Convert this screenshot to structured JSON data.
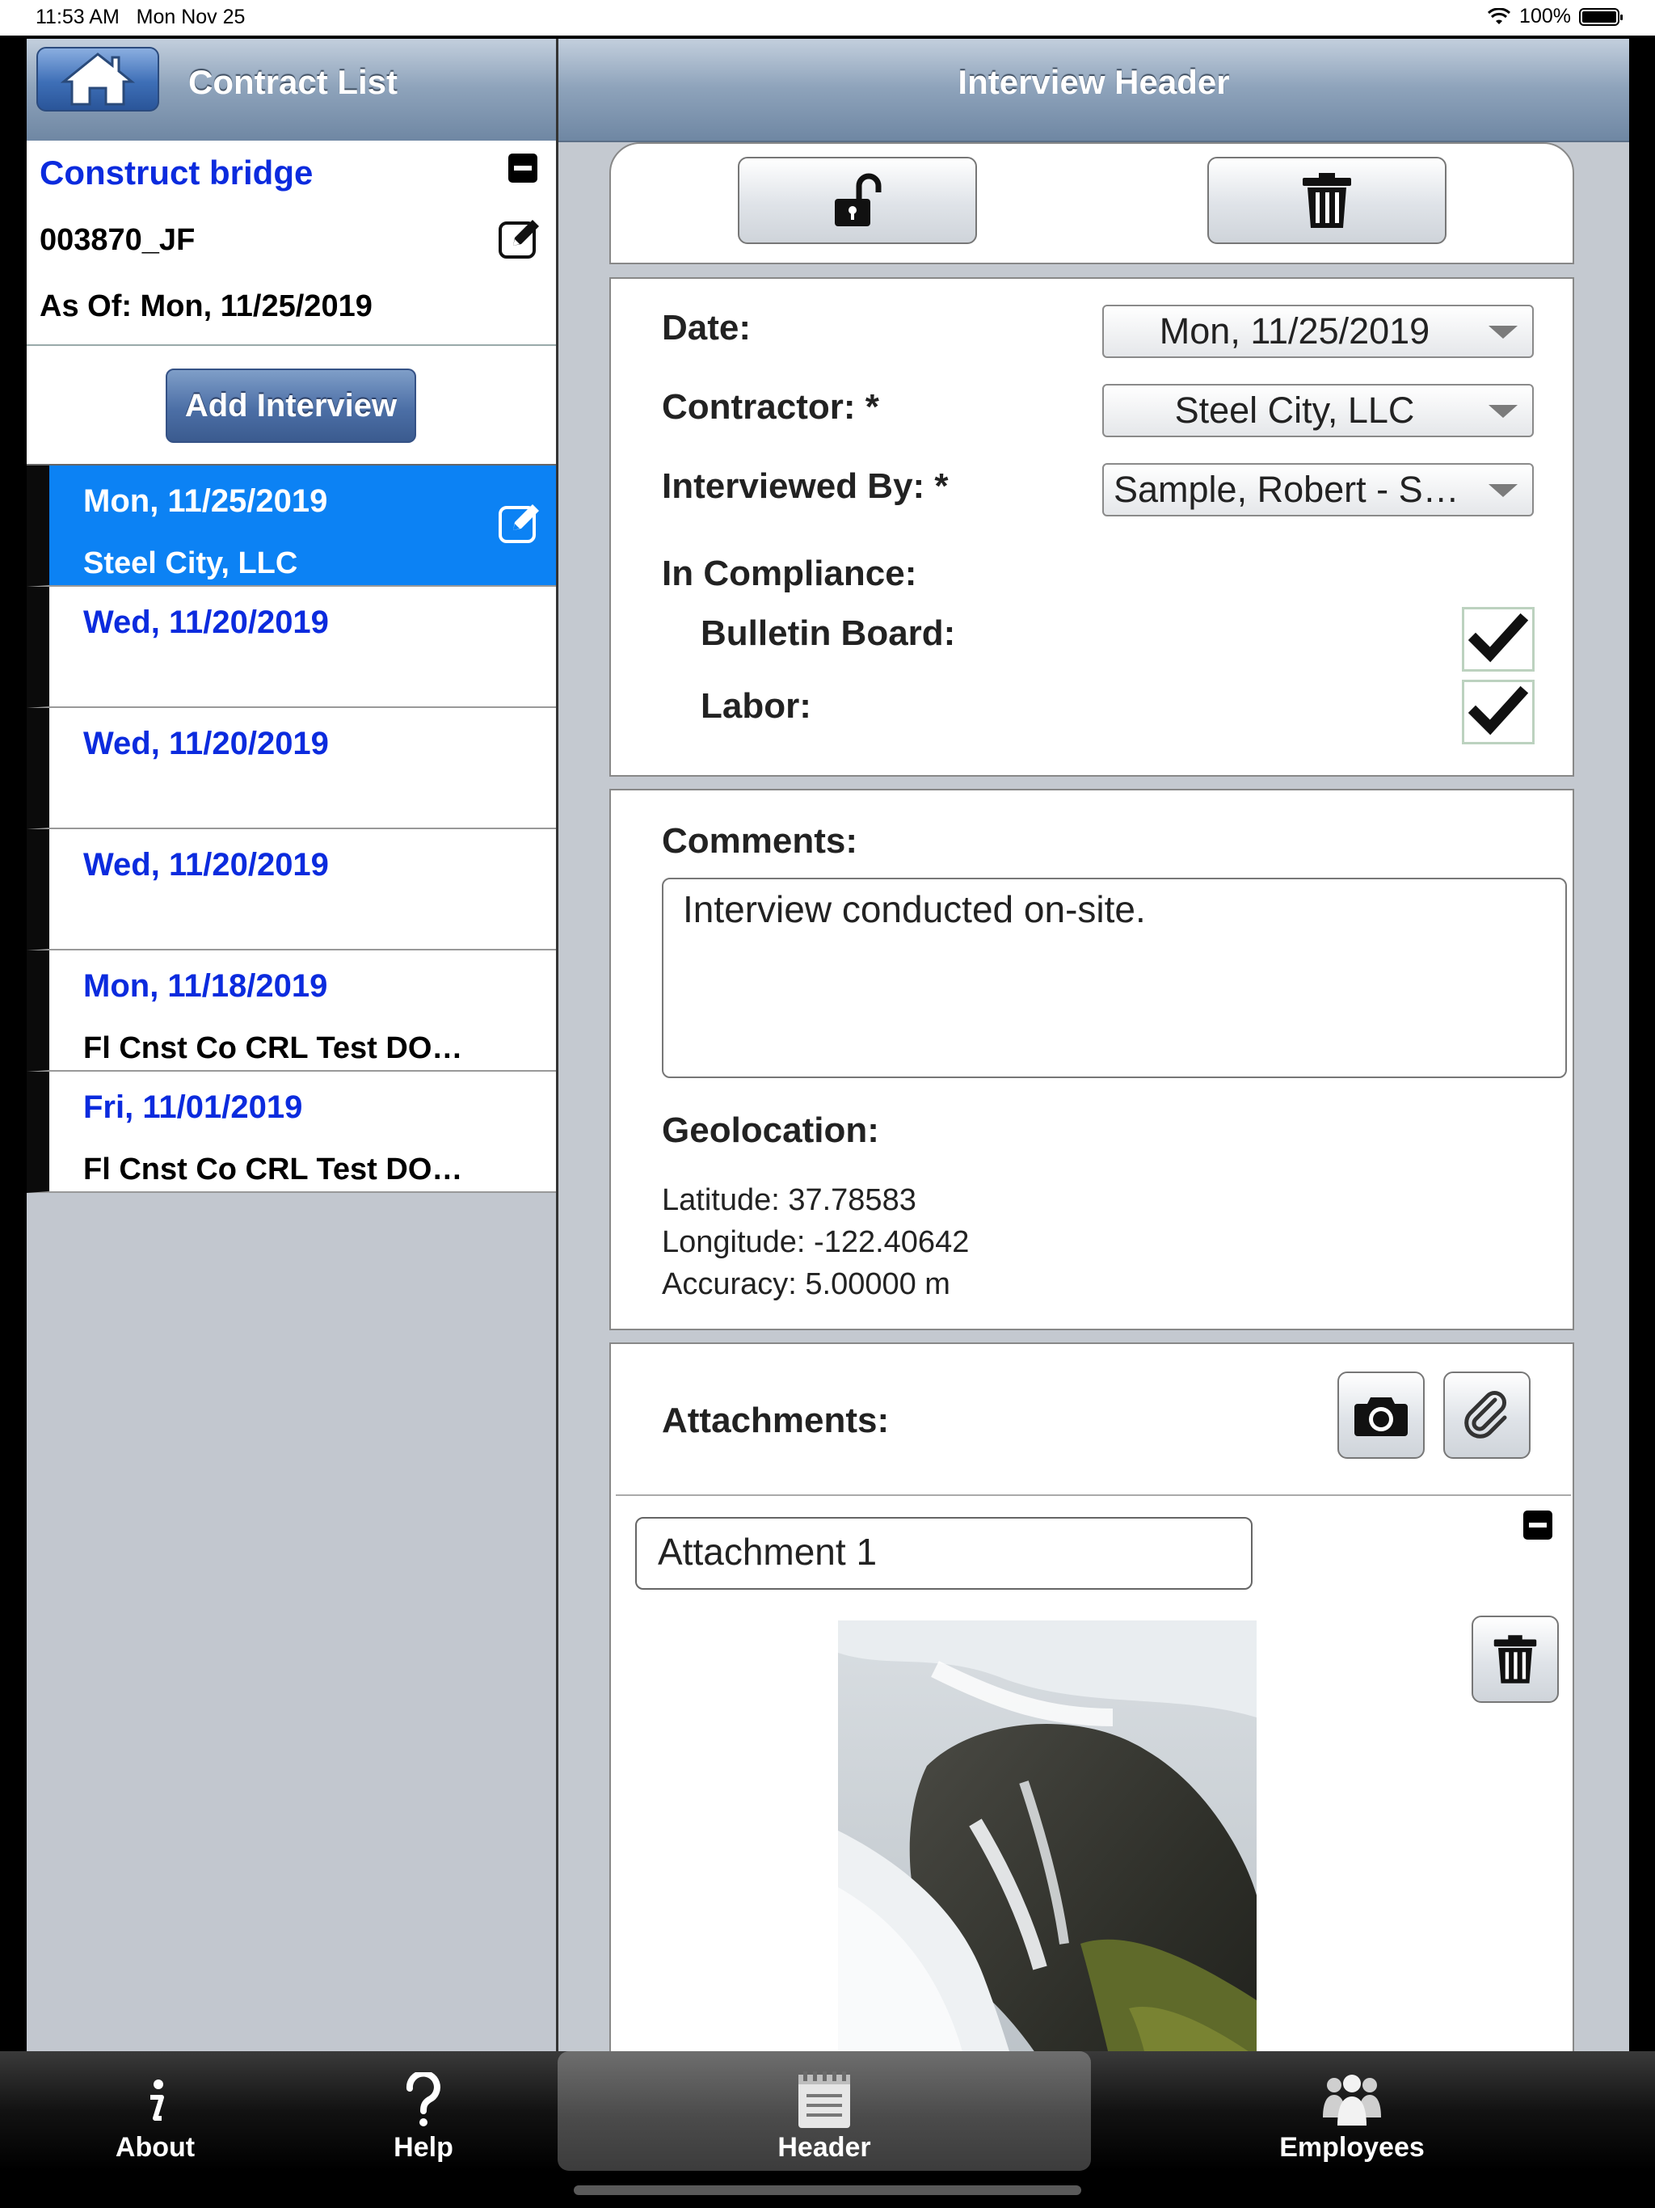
{
  "status_bar": {
    "time": "11:53 AM",
    "date": "Mon Nov 25",
    "battery": "100%"
  },
  "left": {
    "nav_title": "Contract List",
    "contract": {
      "title": "Construct bridge",
      "number": "003870_JF",
      "as_of": "As Of: Mon, 11/25/2019"
    },
    "add_interview_label": "Add Interview",
    "interviews": [
      {
        "date": "Mon, 11/25/2019",
        "contractor": "Steel City, LLC",
        "selected": true
      },
      {
        "date": "Wed, 11/20/2019",
        "contractor": ""
      },
      {
        "date": "Wed, 11/20/2019",
        "contractor": ""
      },
      {
        "date": "Wed, 11/20/2019",
        "contractor": ""
      },
      {
        "date": "Mon, 11/18/2019",
        "contractor": "Fl Cnst Co CRL Test DO…"
      },
      {
        "date": "Fri, 11/01/2019",
        "contractor": "Fl Cnst Co CRL Test DO…"
      }
    ]
  },
  "right": {
    "nav_title": "Interview Header",
    "form": {
      "date_label": "Date:",
      "date_value": "Mon, 11/25/2019",
      "contractor_label": "Contractor: *",
      "contractor_value": "Steel City, LLC",
      "interviewed_by_label": "Interviewed By: *",
      "interviewed_by_value": "Sample, Robert - S…",
      "in_compliance_label": "In Compliance:",
      "bulletin_board_label": "Bulletin Board:",
      "labor_label": "Labor:"
    },
    "comments": {
      "label": "Comments:",
      "value": "Interview conducted on-site."
    },
    "geolocation": {
      "label": "Geolocation:",
      "latitude": "Latitude: 37.78583",
      "longitude": "Longitude: -122.40642",
      "accuracy": "Accuracy: 5.00000 m"
    },
    "attachments": {
      "label": "Attachments:",
      "item_name": "Attachment 1"
    }
  },
  "tabs": [
    {
      "label": "About",
      "icon": "info-icon"
    },
    {
      "label": "Help",
      "icon": "question-icon"
    },
    {
      "label": "Header",
      "icon": "notepad-icon",
      "active": true
    },
    {
      "label": "Employees",
      "icon": "people-icon"
    }
  ]
}
